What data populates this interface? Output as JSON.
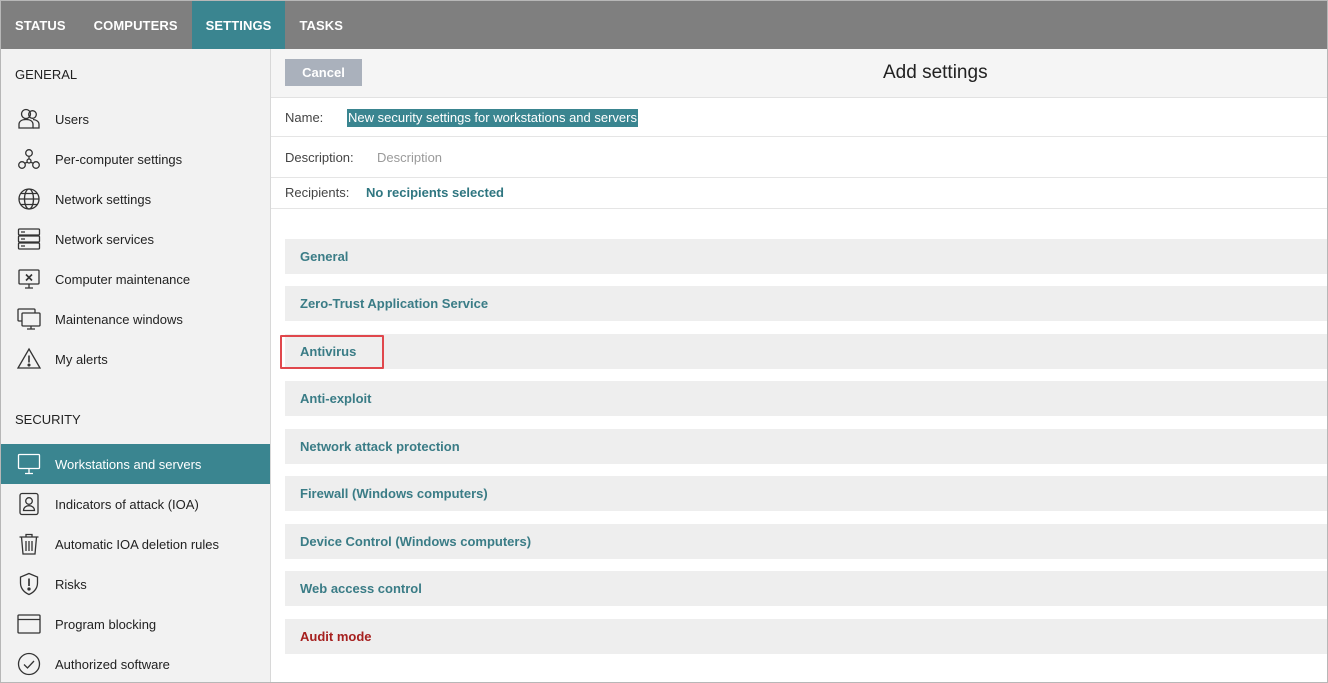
{
  "topnav": {
    "tabs": [
      {
        "label": "STATUS"
      },
      {
        "label": "COMPUTERS"
      },
      {
        "label": "SETTINGS"
      },
      {
        "label": "TASKS"
      }
    ],
    "active": "SETTINGS"
  },
  "sidebar": {
    "general_title": "GENERAL",
    "general_items": [
      {
        "label": "Users",
        "icon": "users-icon"
      },
      {
        "label": "Per-computer settings",
        "icon": "network-nodes-icon"
      },
      {
        "label": "Network settings",
        "icon": "globe-icon"
      },
      {
        "label": "Network services",
        "icon": "server-stack-icon"
      },
      {
        "label": "Computer maintenance",
        "icon": "computer-maintenance-icon"
      },
      {
        "label": "Maintenance windows",
        "icon": "windows-monitor-icon"
      },
      {
        "label": "My alerts",
        "icon": "warning-triangle-icon"
      }
    ],
    "security_title": "SECURITY",
    "security_items": [
      {
        "label": "Workstations and servers",
        "icon": "monitor-icon"
      },
      {
        "label": "Indicators of attack (IOA)",
        "icon": "ioa-badge-icon"
      },
      {
        "label": "Automatic IOA deletion rules",
        "icon": "trash-icon"
      },
      {
        "label": "Risks",
        "icon": "shield-alert-icon"
      },
      {
        "label": "Program blocking",
        "icon": "browser-window-icon"
      },
      {
        "label": "Authorized software",
        "icon": "check-circle-icon"
      }
    ],
    "active_item": "Workstations and servers"
  },
  "main": {
    "cancel_label": "Cancel",
    "title": "Add settings",
    "name_label": "Name:",
    "name_value": "New security settings for workstations and servers",
    "description_label": "Description:",
    "description_placeholder": "Description",
    "recipients_label": "Recipients:",
    "recipients_value": "No recipients selected",
    "sections": [
      {
        "label": "General"
      },
      {
        "label": "Zero-Trust Application Service"
      },
      {
        "label": "Antivirus"
      },
      {
        "label": "Anti-exploit"
      },
      {
        "label": "Network attack protection"
      },
      {
        "label": "Firewall (Windows computers)"
      },
      {
        "label": "Device Control (Windows computers)"
      },
      {
        "label": "Web access control"
      },
      {
        "label": "Audit mode"
      }
    ]
  },
  "colors": {
    "topbar": "#7f7f7f",
    "accent": "#3a8590",
    "link_text": "#3a7c86",
    "audit_text": "#a6201f",
    "highlight": "#e0474c"
  }
}
